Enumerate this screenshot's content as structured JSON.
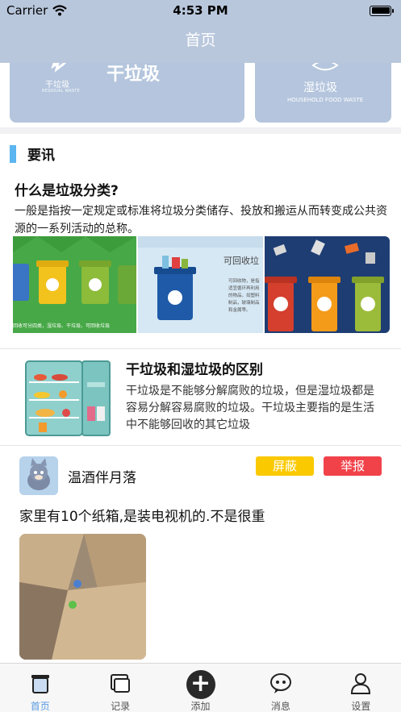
{
  "status_bar": {
    "carrier": "Carrier",
    "time": "4:53 PM"
  },
  "nav": {
    "title": "首页"
  },
  "categories": {
    "dry": {
      "small_label": "干垃圾",
      "english": "RESIDUAL WASTE",
      "name": "干垃圾"
    },
    "wet": {
      "name": "湿垃圾",
      "english": "HOUSEHOLD FOOD WASTE"
    }
  },
  "news": {
    "section_title": "要讯",
    "article1": {
      "title": "什么是垃圾分类?",
      "body": "一般是指按一定规定或标准将垃圾分类储存、投放和搬运从而转变成公共资源的一系列活动的总称。",
      "image2_heading": "可回收垃",
      "image2_text": "可回收物，是指适宜循环再利用的物品，如塑料制品，玻璃制品和金属等。",
      "image1_caption": "回收可分四类，湿垃圾、干垃圾、可回收垃圾"
    },
    "article2": {
      "title": "干垃圾和湿垃圾的区别",
      "body": "干垃圾是不能够分解腐败的垃圾，但是湿垃圾都是容易分解容易腐败的垃圾。干垃圾主要指的是生活中不能够回收的其它垃圾"
    }
  },
  "post": {
    "username": "温酒伴月落",
    "block_label": "屏蔽",
    "report_label": "举报",
    "text": "家里有10个纸箱,是装电视机的.不是很重"
  },
  "tabbar": {
    "items": [
      {
        "label": "首页",
        "icon": "trash-bin-icon",
        "active": true
      },
      {
        "label": "记录",
        "icon": "record-icon",
        "active": false
      },
      {
        "label": "添加",
        "icon": "add-icon",
        "active": false
      },
      {
        "label": "消息",
        "icon": "message-icon",
        "active": false
      },
      {
        "label": "设置",
        "icon": "settings-user-icon",
        "active": false
      }
    ]
  },
  "colors": {
    "nav_bg": "#b9c7dc",
    "accent_blue": "#5bb5f0",
    "block_button": "#fbc900",
    "report_button": "#f1424a",
    "tab_active": "#5a9be0"
  }
}
